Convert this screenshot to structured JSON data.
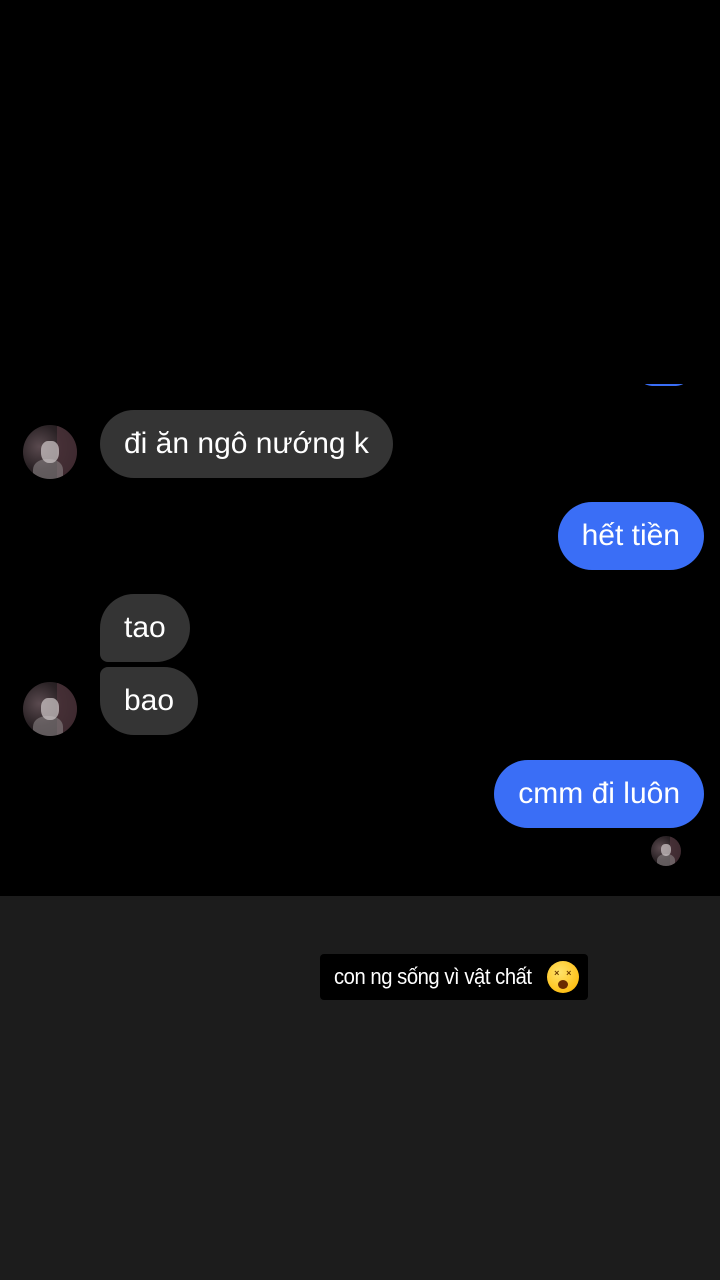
{
  "conversation": {
    "messages": [
      {
        "direction": "incoming",
        "text": "đi ăn ngô nướng k"
      },
      {
        "direction": "outgoing",
        "text": "hết tiền"
      },
      {
        "direction": "incoming",
        "text": "tao"
      },
      {
        "direction": "incoming",
        "text": "bao"
      },
      {
        "direction": "outgoing",
        "text": "cmm đi luôn"
      }
    ],
    "colors": {
      "incoming_bubble": "#343434",
      "outgoing_bubble": "#3a6ef6",
      "background": "#000000"
    }
  },
  "story_caption": {
    "text": "con ng sống vì vật chất",
    "emoji_icon": "dizzy-face-emoji"
  }
}
